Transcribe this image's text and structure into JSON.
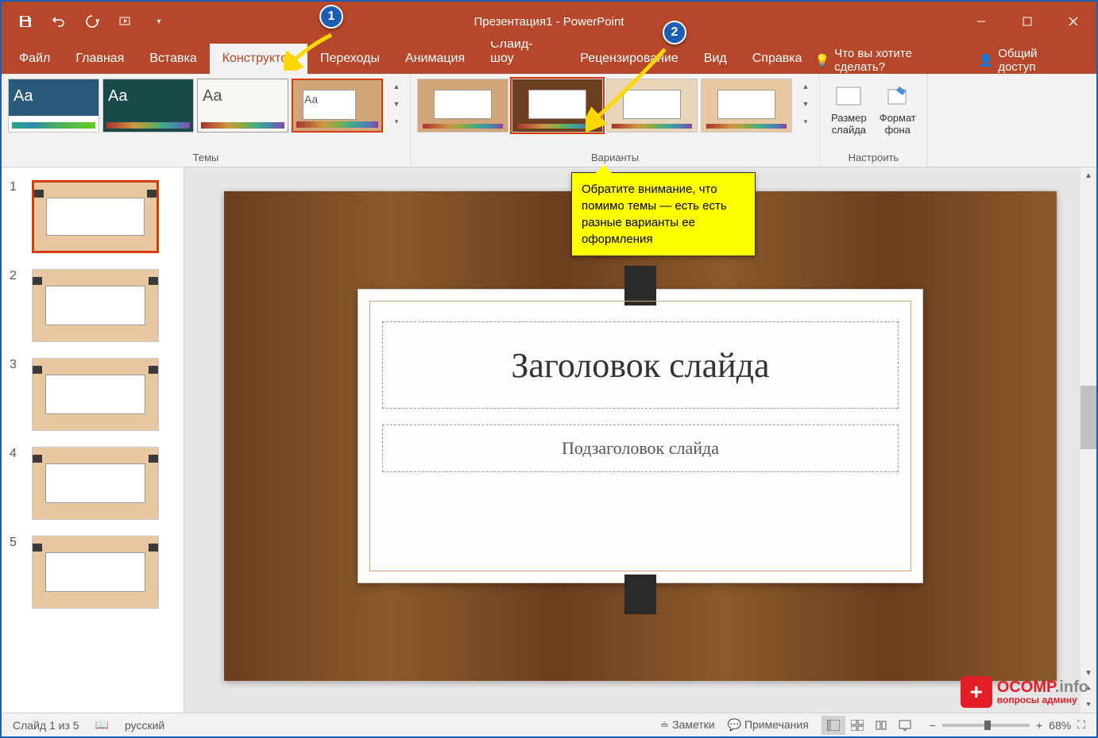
{
  "title": "Презентация1 - PowerPoint",
  "tabs": {
    "file": "Файл",
    "home": "Главная",
    "insert": "Вставка",
    "design": "Конструктор",
    "transitions": "Переходы",
    "animations": "Анимация",
    "slideshow": "Слайд-шоу",
    "review": "Рецензирование",
    "view": "Вид",
    "help": "Справка"
  },
  "tellme": "Что вы хотите сделать?",
  "share": "Общий доступ",
  "ribbon": {
    "themes_label": "Темы",
    "variants_label": "Варианты",
    "customize_label": "Настроить",
    "slide_size": "Размер\nслайда",
    "format_bg": "Формат\nфона"
  },
  "slide": {
    "title_placeholder": "Заголовок слайда",
    "subtitle_placeholder": "Подзаголовок слайда"
  },
  "slides": [
    "1",
    "2",
    "3",
    "4",
    "5"
  ],
  "status": {
    "slide_counter": "Слайд 1 из 5",
    "language": "русский",
    "notes": "Заметки",
    "comments": "Примечания",
    "zoom": "68%"
  },
  "annotations": {
    "marker1": "1",
    "marker2": "2",
    "callout": "Обратите внимание, что помимо темы — есть есть разные варианты ее оформления"
  },
  "watermark": {
    "main": "OCOMP",
    "info": ".info",
    "sub": "вопросы админу"
  }
}
